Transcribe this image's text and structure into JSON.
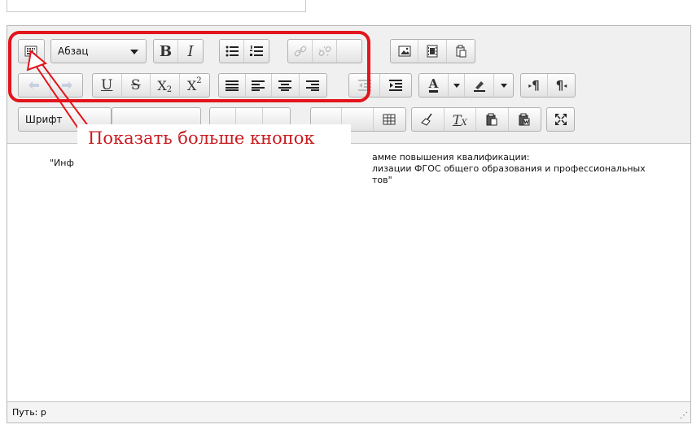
{
  "toolbar": {
    "format_select": {
      "value": "Абзац"
    },
    "font_select": {
      "value": "Шрифт"
    },
    "buttons": {
      "more": {
        "icon": "keyboard-icon"
      },
      "bold": {
        "label": "B"
      },
      "italic": {
        "label": "I"
      },
      "bullets": {
        "icon": "bullet-list-icon"
      },
      "numbers": {
        "icon": "numbered-list-icon"
      },
      "link": {
        "icon": "link-icon"
      },
      "unlink": {
        "icon": "unlink-icon"
      },
      "image": {
        "icon": "image-icon"
      },
      "media": {
        "icon": "film-icon"
      },
      "paste": {
        "icon": "clipboard-icon"
      },
      "undo": {
        "icon": "undo-icon"
      },
      "redo": {
        "icon": "redo-icon"
      },
      "underline": {
        "label": "U"
      },
      "strike": {
        "label": "S"
      },
      "sub": {
        "label": "X",
        "sub": "2"
      },
      "sup": {
        "label": "X",
        "sup": "2"
      },
      "text_color": {
        "label": "A"
      },
      "ltr": {
        "label": "¶"
      },
      "rtl": {
        "label": "¶"
      },
      "remove_format": {
        "label": "T",
        "sub": "X"
      }
    }
  },
  "content": {
    "line1_left": "\"Инф",
    "line1_right": "амме повышения квалификации:",
    "line2_right": "лизации ФГОС общего образования и профессиональных",
    "line3_right": "тов\""
  },
  "statusbar": {
    "path": "Путь: p"
  },
  "annotation": {
    "text": "Показать больше кнопок",
    "color": "#e3141b"
  }
}
